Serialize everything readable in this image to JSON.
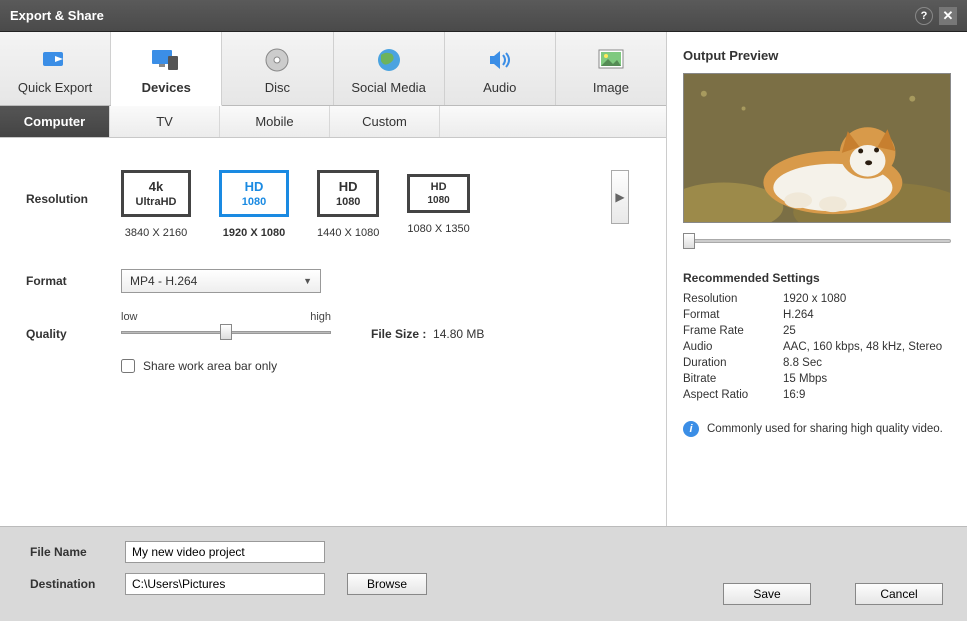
{
  "titlebar": {
    "title": "Export & Share"
  },
  "bigtabs": [
    {
      "label": "Quick Export"
    },
    {
      "label": "Devices"
    },
    {
      "label": "Disc"
    },
    {
      "label": "Social Media"
    },
    {
      "label": "Audio"
    },
    {
      "label": "Image"
    }
  ],
  "subtabs": [
    {
      "label": "Computer"
    },
    {
      "label": "TV"
    },
    {
      "label": "Mobile"
    },
    {
      "label": "Custom"
    }
  ],
  "labels": {
    "resolution": "Resolution",
    "format": "Format",
    "quality": "Quality",
    "filesize_label": "File Size :",
    "share_workarea": "Share work area bar only",
    "file_name": "File Name",
    "destination": "Destination",
    "browse": "Browse",
    "save": "Save",
    "cancel": "Cancel",
    "low": "low",
    "high": "high"
  },
  "resolutions": [
    {
      "top": "4k",
      "mid": "UltraHD",
      "dim": "3840 X 2160"
    },
    {
      "top": "HD",
      "mid": "1080",
      "dim": "1920 X 1080"
    },
    {
      "top": "HD",
      "mid": "1080",
      "dim": "1440 X 1080"
    },
    {
      "top": "HD",
      "mid": "1080",
      "dim": "1080 X 1350"
    }
  ],
  "format_value": "MP4 - H.264",
  "filesize_value": "14.80 MB",
  "filename_value": "My new video project",
  "destination_value": "C:\\Users\\Pictures",
  "preview": {
    "title": "Output Preview",
    "rec_title": "Recommended Settings",
    "rows": [
      {
        "k": "Resolution",
        "v": "1920 x 1080"
      },
      {
        "k": "Format",
        "v": "H.264"
      },
      {
        "k": "Frame Rate",
        "v": "25"
      },
      {
        "k": "Audio",
        "v": "AAC, 160 kbps, 48 kHz, Stereo"
      },
      {
        "k": "Duration",
        "v": "8.8 Sec"
      },
      {
        "k": "Bitrate",
        "v": "15 Mbps"
      },
      {
        "k": "Aspect Ratio",
        "v": "16:9"
      }
    ],
    "tip": "Commonly used for sharing high quality video."
  }
}
